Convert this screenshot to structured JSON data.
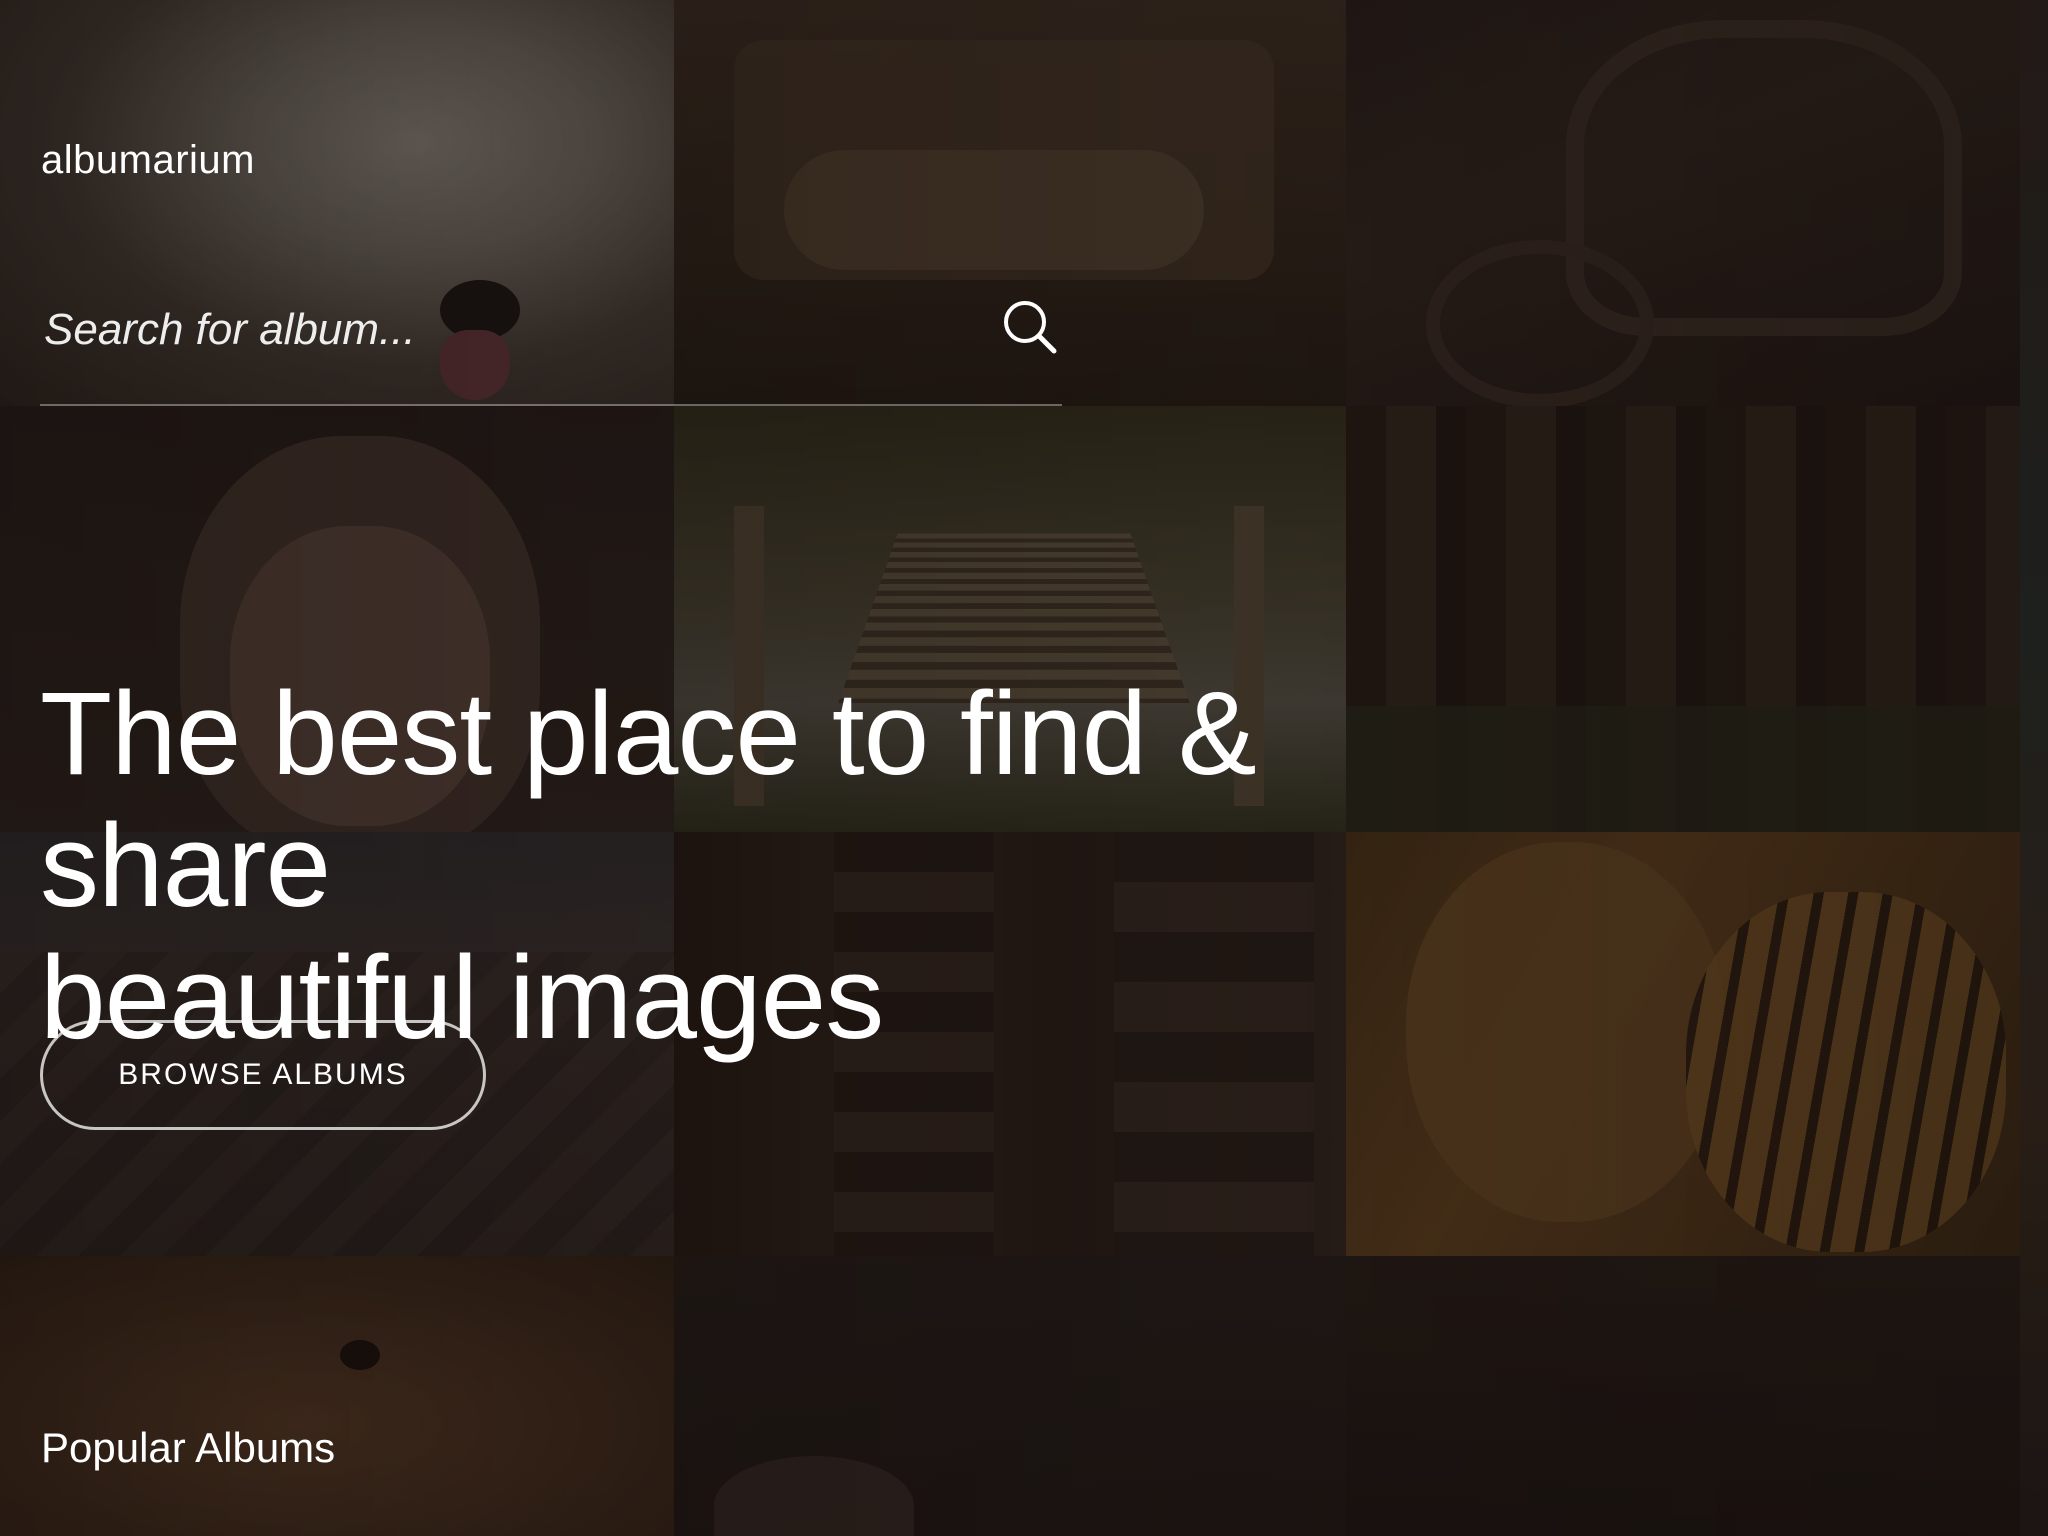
{
  "app": {
    "brand": "albumarium"
  },
  "search": {
    "placeholder": "Search for album...",
    "value": "",
    "icon": "search-icon"
  },
  "hero": {
    "headline_line1": "The best place to find & share",
    "headline_line2": "beautiful images",
    "browse_label": "BROWSE ALBUMS"
  },
  "sections": {
    "popular_title": "Popular Albums"
  },
  "colors": {
    "text": "#ffffff",
    "background": "#1a1412"
  }
}
